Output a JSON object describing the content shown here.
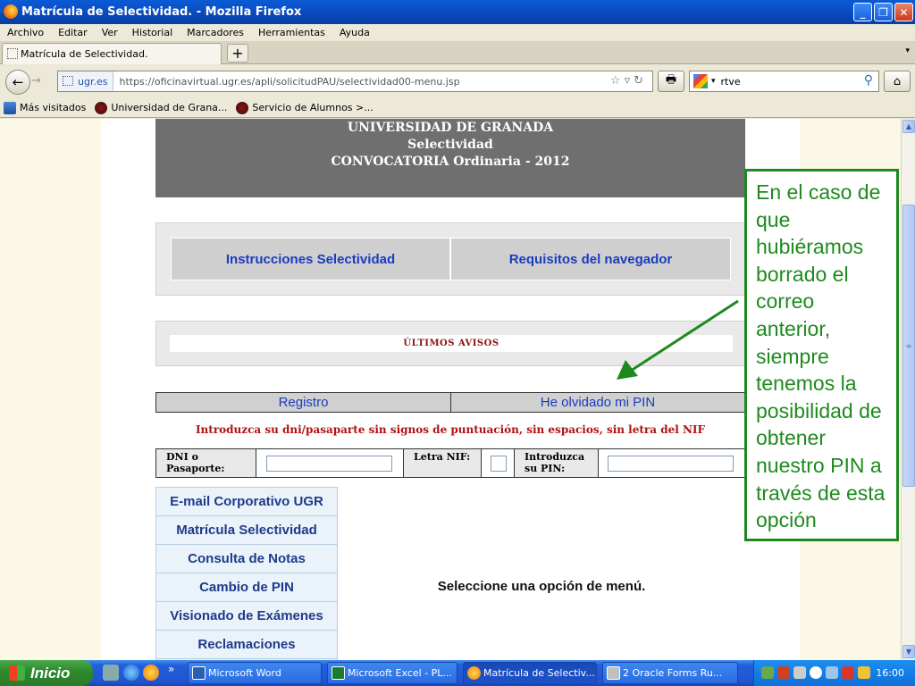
{
  "window": {
    "title": "Matrícula de Selectividad. - Mozilla Firefox",
    "min_glyph": "_",
    "max_glyph": "❐",
    "close_glyph": "✕"
  },
  "menu": [
    "Archivo",
    "Editar",
    "Ver",
    "Historial",
    "Marcadores",
    "Herramientas",
    "Ayuda"
  ],
  "tab": {
    "title": "Matrícula de Selectividad.",
    "new_tab": "+",
    "scroll_glyph": "▾"
  },
  "nav": {
    "back_glyph": "←",
    "forward_glyph": "→",
    "site_badge": "ugr.es",
    "url": "https://oficinavirtual.ugr.es/apli/solicitudPAU/selectividad00-menu.jsp",
    "url_tools": "☆▿↻",
    "print_glyph": "🖶",
    "search_value": "rtve",
    "search_dd": "▾",
    "search_glyph": "⚲",
    "home_glyph": "⌂"
  },
  "bookmarks": [
    "Más visitados",
    "Universidad de Grana...",
    "Servicio de Alumnos >..."
  ],
  "banner": {
    "line1": "UNIVERSIDAD DE GRANADA",
    "line2": "Selectividad",
    "line3": "CONVOCATORIA Ordinaria - 2012"
  },
  "links": {
    "instrucciones": "Instrucciones Selectividad",
    "requisitos": "Requisitos del navegador"
  },
  "avisos": "ÚLTIMOS AVISOS",
  "registro": {
    "left": "Registro",
    "right": "He olvidado mi PIN"
  },
  "instruction": "Introduzca su dni/pasaparte sin signos de puntuación, sin espacios, sin letra del NIF",
  "login": {
    "dni_label": "DNI o Pasaporte:",
    "letra_label": "Letra NIF:",
    "pin_label": "Introduzca su PIN:",
    "dni_value": "",
    "letra_value": "",
    "pin_value": ""
  },
  "left_menu": [
    "E-mail Corporativo UGR",
    "Matrícula Selectividad",
    "Consulta de Notas",
    "Cambio de PIN",
    "Visionado de Exámenes",
    "Reclamaciones"
  ],
  "select_message": "Seleccione una opción de menú.",
  "callout": "En el caso de que hubiéramos borrado el correo anterior, siempre tenemos la posibilidad de obtener nuestro PIN a través de esta opción",
  "scroll": {
    "up": "▲",
    "down": "▼",
    "grip": "≡"
  },
  "taskbar": {
    "start": "Inicio",
    "quicklaunch_more": "»",
    "buttons": [
      "Microsoft Word",
      "Microsoft Excel - PL...",
      "Matrícula de Selectiv...",
      "2 Oracle Forms Ru..."
    ],
    "clock": "16:00"
  },
  "colors": {
    "accent_green": "#1e8a1e",
    "link_blue": "#1a3cc0",
    "avisos_red": "#8b1010"
  }
}
